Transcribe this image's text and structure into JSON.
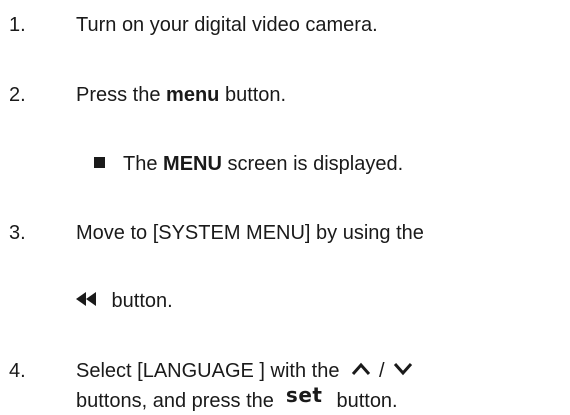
{
  "steps": [
    {
      "number": "1.",
      "text": "Turn on your digital video camera."
    },
    {
      "number": "2.",
      "prefix": "Press the ",
      "bold": "menu",
      "suffix": " button."
    },
    {
      "note_bold": "MENU",
      "note_prefix": "The ",
      "note_suffix": " screen is displayed."
    },
    {
      "number": "3.",
      "line1": "Move to [SYSTEM MENU] by using the",
      "line2": " button.",
      "icon": "rewind-icon"
    },
    {
      "number": "4.",
      "line1": "Select [LANGUAGE ] with the",
      "separator": "/",
      "line2_prefix": "buttons, and press the",
      "set_label": "set",
      "line2_suffix": "button.",
      "icons": [
        "up-arrow-icon",
        "down-arrow-icon"
      ]
    }
  ],
  "colors": {
    "text": "#1a1a1a"
  }
}
